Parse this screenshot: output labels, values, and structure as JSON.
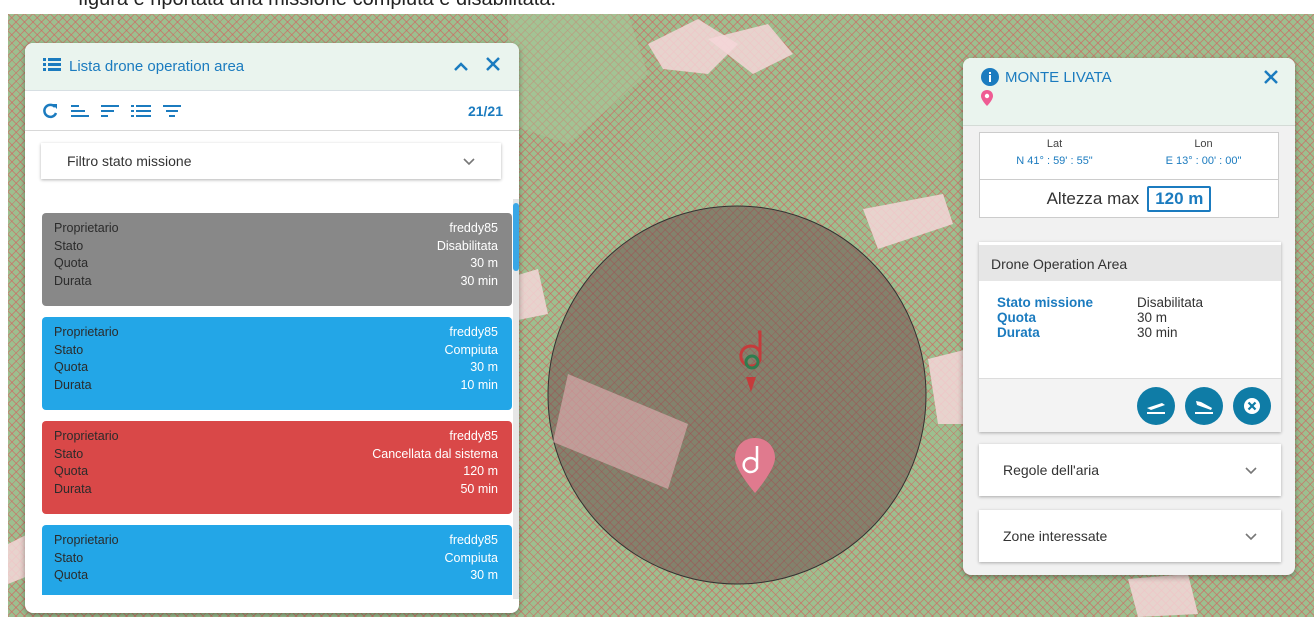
{
  "caption": "figura è riportata una missione compiuta e disabilitata.",
  "list_panel": {
    "title": "Lista drone operation area",
    "count": "21/21",
    "filter_label": "Filtro stato missione",
    "tools": [
      "refresh-icon",
      "align-left-icon",
      "sort-icon",
      "list-icon",
      "filter-icon"
    ],
    "missions": [
      {
        "color": "#888888",
        "rows": [
          [
            "Proprietario",
            "freddy85"
          ],
          [
            "Stato",
            "Disabilitata"
          ],
          [
            "Quota",
            "30 m"
          ],
          [
            "Durata",
            "30 min"
          ]
        ]
      },
      {
        "color": "#23a6e7",
        "rows": [
          [
            "Proprietario",
            "freddy85"
          ],
          [
            "Stato",
            "Compiuta"
          ],
          [
            "Quota",
            "30 m"
          ],
          [
            "Durata",
            "10 min"
          ]
        ]
      },
      {
        "color": "#d94848",
        "rows": [
          [
            "Proprietario",
            "freddy85"
          ],
          [
            "Stato",
            "Cancellata dal sistema"
          ],
          [
            "Quota",
            "120 m"
          ],
          [
            "Durata",
            "50 min"
          ]
        ]
      },
      {
        "color": "#23a6e7",
        "rows": [
          [
            "Proprietario",
            "freddy85"
          ],
          [
            "Stato",
            "Compiuta"
          ],
          [
            "Quota",
            "30 m"
          ]
        ]
      }
    ]
  },
  "info_panel": {
    "title": "MONTE LIVATA",
    "lat_label": "Lat",
    "lon_label": "Lon",
    "lat_value": "N 41° : 59' : 55\"",
    "lon_value": "E 13° : 00' : 00\"",
    "alt_label": "Altezza max",
    "alt_value": "120 m",
    "doa_title": "Drone Operation Area",
    "doa_rows": [
      [
        "Stato missione",
        "Disabilitata"
      ],
      [
        "Quota",
        "30 m"
      ],
      [
        "Durata",
        "30 min"
      ]
    ],
    "accordions": [
      "Regole dell'aria",
      "Zone interessate"
    ]
  },
  "colors": {
    "accent": "#1b7bbf",
    "action": "#0f7ca6",
    "disabled": "#888888",
    "completed": "#23a6e7",
    "cancelled": "#d94848"
  }
}
